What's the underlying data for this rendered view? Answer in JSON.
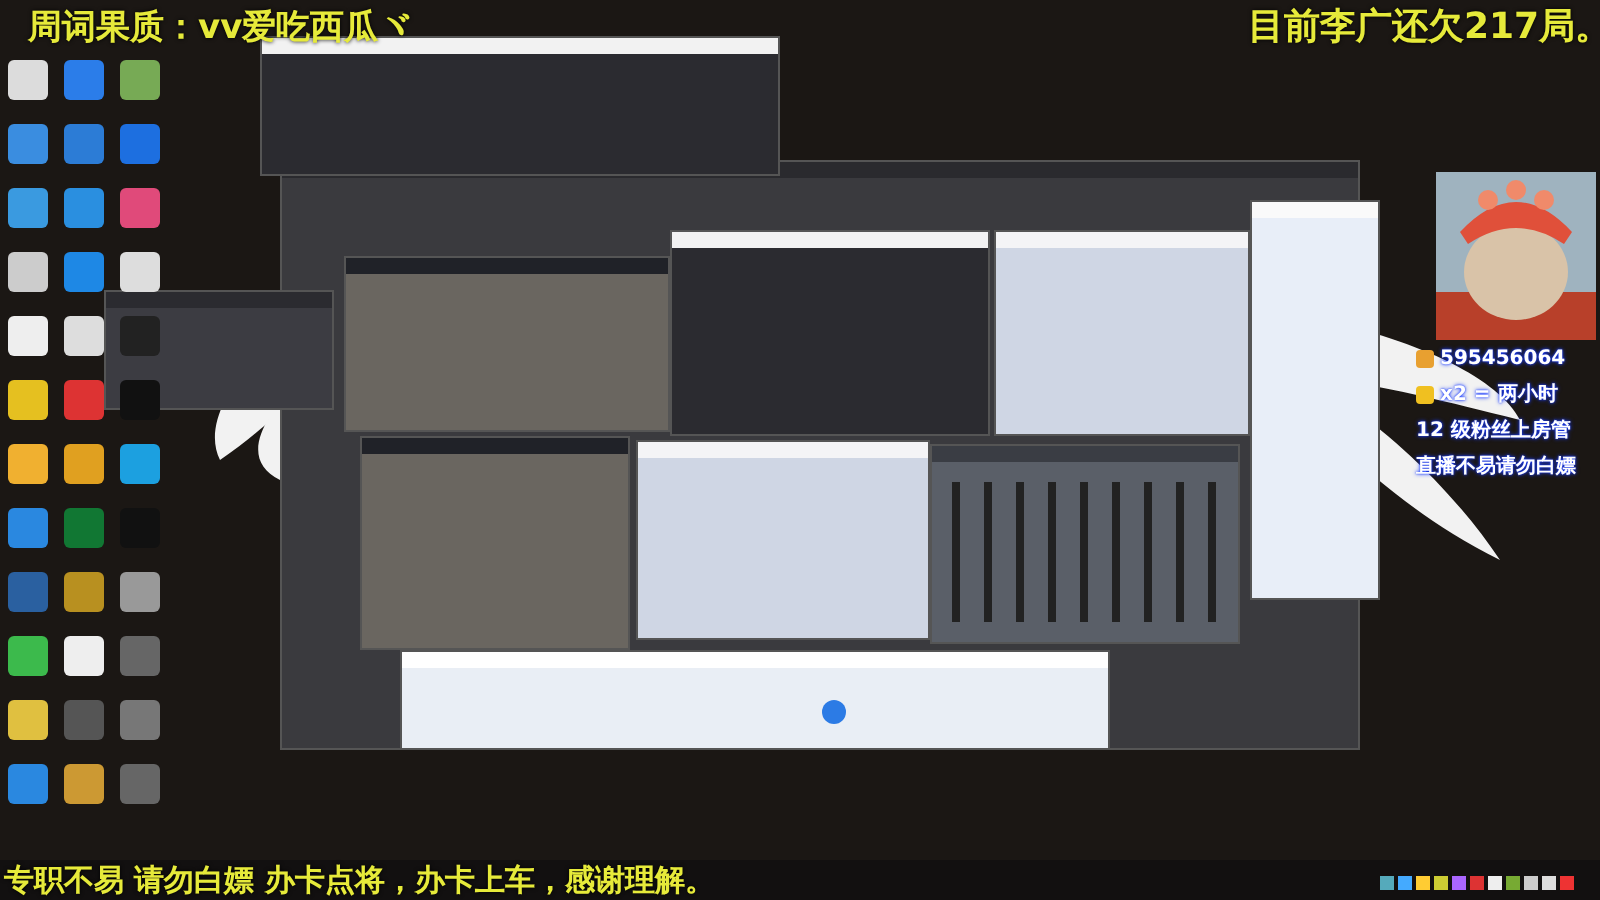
{
  "overlay": {
    "top_left": "周词果质：vv爱吃西瓜ヾ",
    "top_right": "目前李广还欠217局。",
    "bottom": "专职不易 请勿白嫖 办卡点将，办卡上车，感谢理解。"
  },
  "side_notes": [
    {
      "kind": "money",
      "text": "595456064"
    },
    {
      "kind": "ticket",
      "text": "x2 = 两小时"
    },
    {
      "kind": "plain",
      "text": "12 级粉丝上房管"
    },
    {
      "kind": "plain",
      "text": "直播不易请勿白嫖"
    }
  ],
  "windows": [
    {
      "kind": "dark"
    },
    {
      "kind": "obs"
    },
    {
      "kind": "dock"
    },
    {
      "kind": "game"
    },
    {
      "kind": "obs"
    },
    {
      "kind": "light"
    },
    {
      "kind": "panel"
    },
    {
      "kind": "game"
    },
    {
      "kind": "light"
    },
    {
      "kind": "mixer"
    },
    {
      "kind": "player"
    }
  ]
}
